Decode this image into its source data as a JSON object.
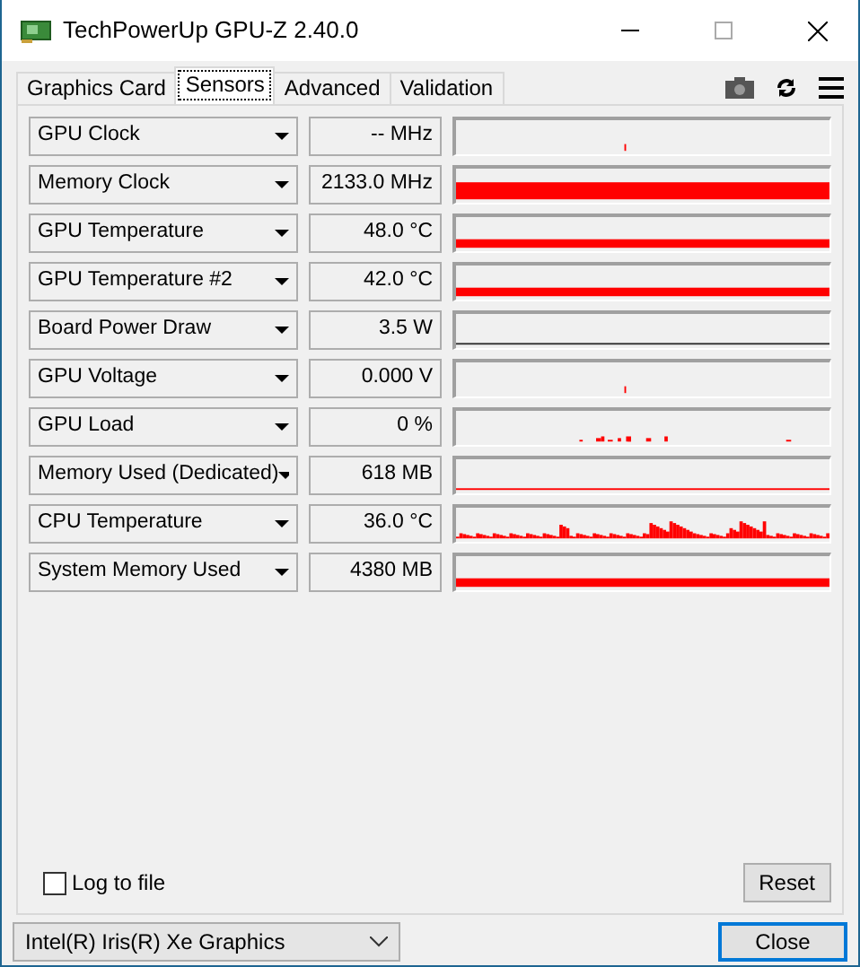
{
  "window": {
    "title": "TechPowerUp GPU-Z 2.40.0"
  },
  "tabs": [
    {
      "label": "Graphics Card",
      "selected": false
    },
    {
      "label": "Sensors",
      "selected": true
    },
    {
      "label": "Advanced",
      "selected": false
    },
    {
      "label": "Validation",
      "selected": false
    }
  ],
  "sensors": [
    {
      "name": "GPU Clock",
      "reading": "-- MHz",
      "kind": "tick"
    },
    {
      "name": "Memory Clock",
      "reading": "2133.0 MHz",
      "kind": "full"
    },
    {
      "name": "GPU Temperature",
      "reading": "48.0 °C",
      "kind": "thin"
    },
    {
      "name": "GPU Temperature #2",
      "reading": "42.0 °C",
      "kind": "thin"
    },
    {
      "name": "Board Power Draw",
      "reading": "3.5 W",
      "kind": "baseline"
    },
    {
      "name": "GPU Voltage",
      "reading": "0.000 V",
      "kind": "tick"
    },
    {
      "name": "GPU Load",
      "reading": "0 %",
      "kind": "sparse"
    },
    {
      "name": "Memory Used (Dedicated)",
      "reading": "618 MB",
      "kind": "line"
    },
    {
      "name": "CPU Temperature",
      "reading": "36.0 °C",
      "kind": "busy"
    },
    {
      "name": "System Memory Used",
      "reading": "4380 MB",
      "kind": "thin"
    }
  ],
  "log_to_file": {
    "label": "Log to file",
    "checked": false
  },
  "reset_button": "Reset",
  "gpu_select": {
    "value": "Intel(R) Iris(R) Xe Graphics"
  },
  "close_button": "Close"
}
